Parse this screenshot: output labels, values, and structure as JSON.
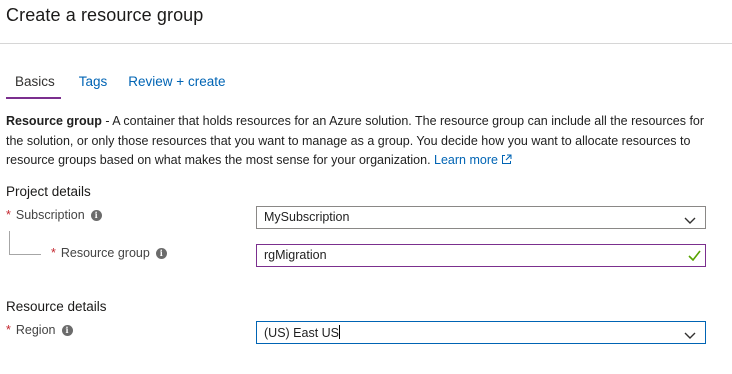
{
  "header": {
    "title": "Create a resource group"
  },
  "tabs": [
    {
      "label": "Basics",
      "active": true
    },
    {
      "label": "Tags",
      "active": false
    },
    {
      "label": "Review + create",
      "active": false
    }
  ],
  "description": {
    "lead": "Resource group",
    "text": " - A container that holds resources for an Azure solution. The resource group can include all the resources for the solution, or only those resources that you want to manage as a group. You decide how you want to allocate resources to resource groups based on what makes the most sense for your organization. ",
    "link": "Learn more"
  },
  "project_details": {
    "heading": "Project details",
    "subscription": {
      "label": "Subscription",
      "value": "MySubscription"
    },
    "resource_group": {
      "label": "Resource group",
      "value": "rgMigration"
    }
  },
  "resource_details": {
    "heading": "Resource details",
    "region": {
      "label": "Region",
      "value": "(US) East US"
    }
  },
  "colors": {
    "accent_purple": "#7b2f8e",
    "link_blue": "#0064b4",
    "required_red": "#c4262e",
    "valid_green": "#57a300"
  },
  "icons": {
    "required": "*",
    "info": "i"
  }
}
